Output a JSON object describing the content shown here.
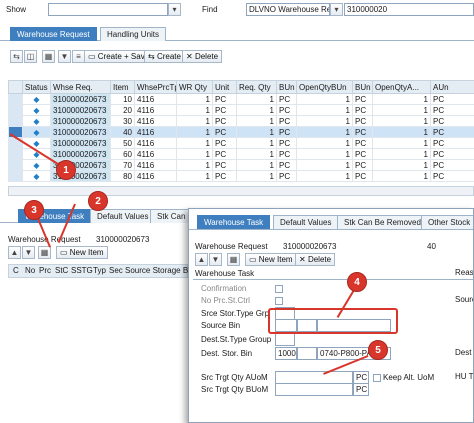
{
  "top": {
    "show_label": "Show",
    "show_value": "",
    "find_label": "Find",
    "find_value": "DLVNO Warehouse Req...",
    "find_number": "310000020"
  },
  "upper_tabs": [
    "Warehouse Request",
    "Handling Units"
  ],
  "upper_toolbar": {
    "create_save": "Create + Save",
    "create": "Create",
    "delete": "Delete"
  },
  "upper_table": {
    "columns": [
      "Status",
      "Whse Req.",
      "Item",
      "WhsePrcTpe",
      "WR Qty",
      "Unit",
      "Req. Qty",
      "BUn",
      "OpenQtyBUn",
      "BUn",
      "OpenQtyA...",
      "AUn"
    ],
    "rows": [
      [
        "◆",
        "310000020673",
        "10",
        "4116",
        "1",
        "PC",
        "1",
        "PC",
        "1",
        "PC",
        "1",
        "PC"
      ],
      [
        "◆",
        "310000020673",
        "20",
        "4116",
        "1",
        "PC",
        "1",
        "PC",
        "1",
        "PC",
        "1",
        "PC"
      ],
      [
        "◆",
        "310000020673",
        "30",
        "4116",
        "1",
        "PC",
        "1",
        "PC",
        "1",
        "PC",
        "1",
        "PC"
      ],
      [
        "◆",
        "310000020673",
        "40",
        "4116",
        "1",
        "PC",
        "1",
        "PC",
        "1",
        "PC",
        "1",
        "PC"
      ],
      [
        "◆",
        "310000020673",
        "50",
        "4116",
        "1",
        "PC",
        "1",
        "PC",
        "1",
        "PC",
        "1",
        "PC"
      ],
      [
        "◆",
        "310000020673",
        "60",
        "4116",
        "1",
        "PC",
        "1",
        "PC",
        "1",
        "PC",
        "1",
        "PC"
      ],
      [
        "◆",
        "310000020673",
        "70",
        "4116",
        "1",
        "PC",
        "1",
        "PC",
        "1",
        "PC",
        "1",
        "PC"
      ],
      [
        "◆",
        "310000020673",
        "80",
        "4116",
        "1",
        "PC",
        "1",
        "PC",
        "1",
        "PC",
        "1",
        "PC"
      ]
    ]
  },
  "lower_tabs": [
    "Warehouse Task",
    "Default Values",
    "Stk Can Be Re"
  ],
  "lower_panel": {
    "wr_label": "Warehouse Request",
    "wr_value": "310000020673",
    "new_item": "New Item",
    "columns": [
      "C",
      "No",
      "Prc",
      "StC",
      "SSTG",
      "Typ",
      "Sec",
      "Source Storage Bin"
    ]
  },
  "dialog": {
    "tabs": [
      "Warehouse Task",
      "Default Values",
      "Stk Can Be Removed",
      "Other Stock"
    ],
    "wr_label": "Warehouse Request",
    "wr_value": "310000020673",
    "wr_item": "40",
    "new_item": "New Item",
    "delete": "Delete",
    "section": "Warehouse Task",
    "confirmation": "Confirmation",
    "no_prc_st_ctrl": "No Prc.St.Ctrl",
    "srce_stor_type_grp": "Srce Stor.Type Grp",
    "source_bin": "Source Bin",
    "dest_st_type_group": "Dest.St.Type Group",
    "dest_stor_bin": "Dest. Stor. Bin",
    "dest_bin_1": "1000",
    "dest_bin_2": "0740-P800-PA",
    "src_trgt_qty_auom": "Src Trgt Qty AUoM",
    "qty_unit_1": "PC",
    "keep_alt_uom": "Keep Alt. UoM",
    "src_trgt_qty_buom": "Src Trgt Qty BUoM",
    "qty_unit_2": "PC",
    "right_1": "Reas",
    "right_2": "Sourc",
    "right_3": "Dest",
    "right_4": "HU T"
  },
  "badges": [
    "1",
    "2",
    "3",
    "4",
    "5"
  ],
  "colors": {
    "accent": "#3f7fbf",
    "callout": "#d9362b",
    "status_icon": "#1f7fc9"
  }
}
